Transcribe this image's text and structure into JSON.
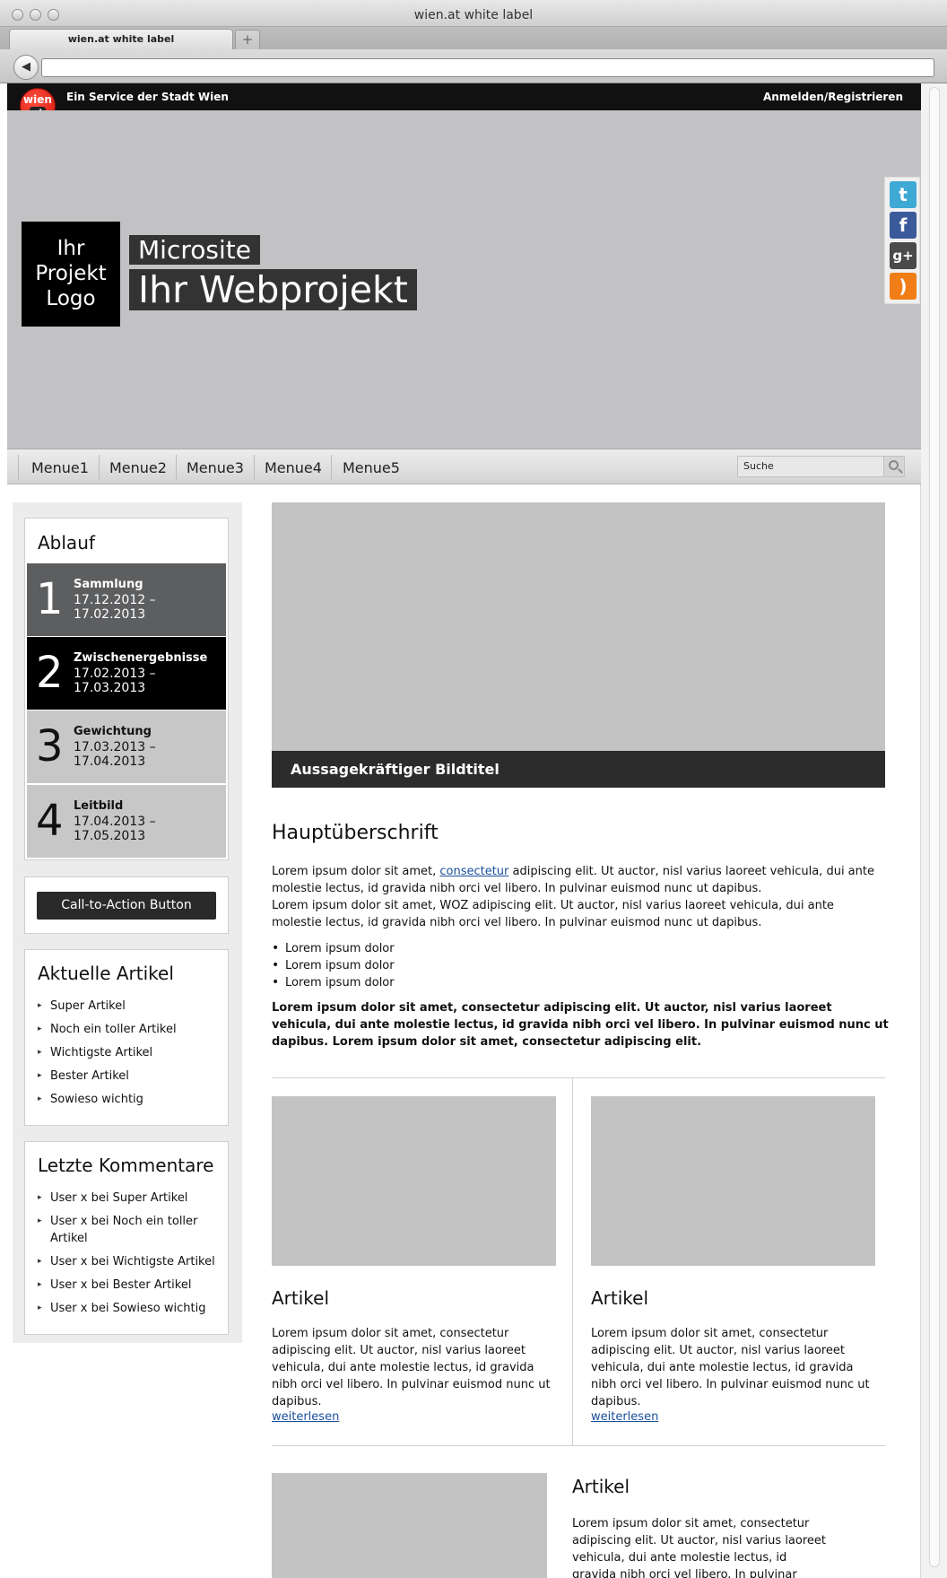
{
  "window": {
    "title": "wien.at white label",
    "tab_label": "wien.at white label",
    "new_tab": "+",
    "back": "◀"
  },
  "servicebar": {
    "logo_top": "wien",
    "logo_bottom": "at",
    "service_text": "Ein Service der Stadt Wien",
    "login": "Anmelden/Registrieren"
  },
  "header": {
    "logo_lines": [
      "Ihr",
      "Projekt",
      "Logo"
    ],
    "subtitle": "Microsite",
    "title": "Ihr Webprojekt",
    "social": [
      {
        "icon": "twitter-icon",
        "glyph": "t",
        "color": "#3fa9d6"
      },
      {
        "icon": "facebook-icon",
        "glyph": "f",
        "color": "#3b5a9a"
      },
      {
        "icon": "googleplus-icon",
        "glyph": "g+",
        "color": "#4a4a4a"
      },
      {
        "icon": "rss-icon",
        "glyph": ")",
        "color": "#f07d16"
      }
    ]
  },
  "nav": {
    "items": [
      "Menue1",
      "Menue2",
      "Menue3",
      "Menue4",
      "Menue5"
    ],
    "search_value": "Suche",
    "search_icon": "search-icon"
  },
  "sidebar": {
    "ablauf_title": "Ablauf",
    "steps": [
      {
        "num": "1",
        "label": "Sammlung",
        "dates": "17.12.2012 – 17.02.2013",
        "bg": "#5d5e60",
        "color": "#ffffff"
      },
      {
        "num": "2",
        "label": "Zwischenergebnisse",
        "dates": "17.02.2013 – 17.03.2013",
        "bg": "#000000",
        "color": "#ffffff"
      },
      {
        "num": "3",
        "label": "Gewichtung",
        "dates": "17.03.2013 – 17.04.2013",
        "bg": "#c7c7c8",
        "color": "#111111"
      },
      {
        "num": "4",
        "label": "Leitbild",
        "dates": "17.04.2013 – 17.05.2013",
        "bg": "#c7c7c8",
        "color": "#111111"
      }
    ],
    "cta_label": "Call-to-Action Button",
    "articles_title": "Aktuelle Artikel",
    "articles": [
      "Super Artikel",
      "Noch ein toller Artikel",
      "Wichtigste Artikel",
      "Bester Artikel",
      "Sowieso wichtig"
    ],
    "comments_title": "Letzte Kommentare",
    "comments": [
      "User x bei Super Artikel",
      "User x bei Noch ein toller Artikel",
      "User x bei Wichtigste Artikel",
      "User x bei Bester Artikel",
      "User x bei Sowieso wichtig"
    ]
  },
  "main": {
    "image_caption": "Aussagekräftiger Bildtitel",
    "heading": "Hauptüberschrift",
    "p1_before": "Lorem ipsum dolor sit amet, ",
    "p1_link": "consectetur",
    "p1_after": " adipiscing elit. Ut auctor, nisl varius laoreet vehicula, dui ante molestie lectus, id gravida nibh orci vel libero. In pulvinar euismod nunc ut dapibus.",
    "p2": "Lorem ipsum dolor sit amet, WOZ adipiscing elit. Ut auctor, nisl varius laoreet vehicula, dui ante molestie lectus, id gravida nibh orci vel libero. In pulvinar euismod nunc ut dapibus.",
    "bullets": [
      "Lorem ipsum dolor",
      "Lorem ipsum dolor",
      "Lorem ipsum dolor"
    ],
    "bold_para": "Lorem ipsum dolor sit amet, consectetur adipiscing elit. Ut auctor, nisl varius laoreet vehicula, dui ante molestie lectus, id gravida nibh orci vel libero. In pulvinar euismod nunc ut dapibus. Lorem ipsum dolor sit amet, consectetur adipiscing elit.",
    "articles": [
      {
        "title": "Artikel",
        "text": "Lorem ipsum dolor sit amet, consectetur adipiscing elit. Ut auctor, nisl varius laoreet vehicula, dui ante molestie lectus, id gravida nibh orci vel libero. In pulvinar euismod nunc ut dapibus.",
        "link": "weiterlesen"
      },
      {
        "title": "Artikel",
        "text": "Lorem ipsum dolor sit amet, consectetur adipiscing elit. Ut auctor, nisl varius laoreet vehicula, dui ante molestie lectus, id gravida nibh orci vel libero. In pulvinar euismod nunc ut dapibus.",
        "link": "weiterlesen"
      },
      {
        "title": "Artikel",
        "text": "Lorem ipsum dolor sit amet, consectetur adipiscing elit. Ut auctor, nisl varius laoreet vehicula, dui ante molestie lectus, id gravida nibh orci vel libero. In pulvinar euismod nunc ut"
      }
    ]
  }
}
